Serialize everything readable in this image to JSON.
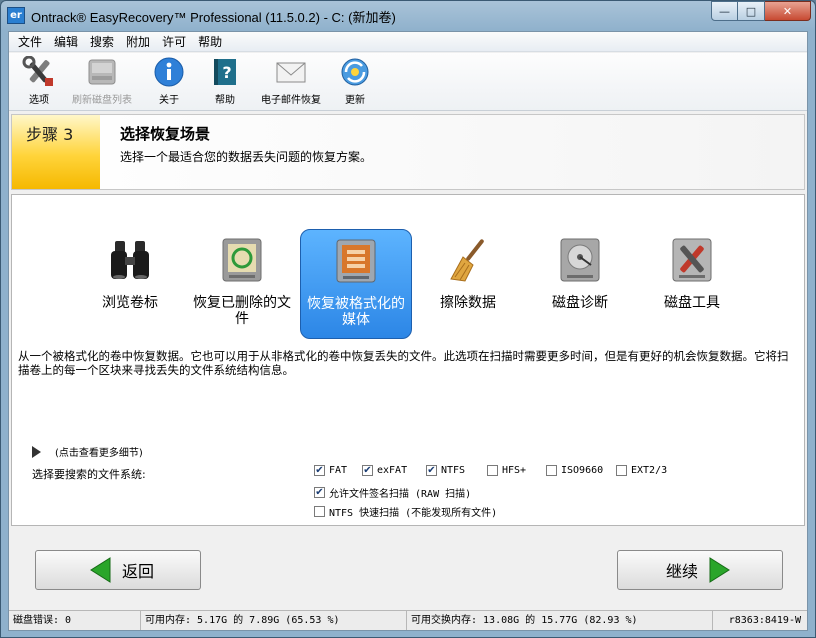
{
  "window": {
    "app_icon": "er",
    "title": "Ontrack® EasyRecovery™ Professional (11.5.0.2) - C: (新加卷)",
    "minimize_icon": "minimize-icon",
    "maximize_icon": "maximize-icon",
    "close_icon": "close-icon"
  },
  "menu": [
    "文件",
    "编辑",
    "搜索",
    "附加",
    "许可",
    "帮助"
  ],
  "toolbar": [
    {
      "label": "选项",
      "icon": "tools-icon",
      "enabled": true
    },
    {
      "label": "刷新磁盘列表",
      "icon": "disk-refresh-icon",
      "enabled": false
    },
    {
      "label": "关于",
      "icon": "info-icon",
      "enabled": true
    },
    {
      "label": "帮助",
      "icon": "help-book-icon",
      "enabled": true
    },
    {
      "label": "电子邮件恢复",
      "icon": "envelope-icon",
      "enabled": true
    },
    {
      "label": "更新",
      "icon": "update-globe-icon",
      "enabled": true
    }
  ],
  "step": {
    "number": "步骤 3",
    "title": "选择恢复场景",
    "subtitle": "选择一个最适合您的数据丢失问题的恢复方案。"
  },
  "scenarios": [
    {
      "label": "浏览卷标",
      "icon": "binoculars-icon",
      "selected": false
    },
    {
      "label": "恢复已删除的文件",
      "icon": "recycle-drive-icon",
      "selected": false
    },
    {
      "label": "恢复被格式化的媒体",
      "icon": "format-drive-icon",
      "selected": true
    },
    {
      "label": "擦除数据",
      "icon": "broom-icon",
      "selected": false
    },
    {
      "label": "磁盘诊断",
      "icon": "hdd-diagnose-icon",
      "selected": false
    },
    {
      "label": "磁盘工具",
      "icon": "disk-tools-icon",
      "selected": false
    }
  ],
  "description": "从一个被格式化的卷中恢复数据。它也可以用于从非格式化的卷中恢复丢失的文件。此选项在扫描时需要更多时间，但是有更好的机会恢复数据。它将扫描卷上的每一个区块来寻找丢失的文件系统结构信息。",
  "more_details": "(点击查看更多细节)",
  "fs_label": "选择要搜索的文件系统:",
  "filesystems": [
    {
      "label": "FAT",
      "checked": true
    },
    {
      "label": "exFAT",
      "checked": true
    },
    {
      "label": "NTFS",
      "checked": true
    },
    {
      "label": "HFS+",
      "checked": false
    },
    {
      "label": "ISO9660",
      "checked": false
    },
    {
      "label": "EXT2/3",
      "checked": false
    }
  ],
  "options": [
    {
      "label": "允许文件签名扫描 (RAW 扫描)",
      "checked": true
    },
    {
      "label": "NTFS 快速扫描 (不能发现所有文件)",
      "checked": false
    }
  ],
  "buttons": {
    "back": "返回",
    "next": "继续"
  },
  "status": {
    "disk_errors": "磁盘错误: 0",
    "memory": "可用内存: 5.17G 的 7.89G (65.53 %)",
    "swap": "可用交换内存: 13.08G 的 15.77G (82.93 %)",
    "build": "r8363:8419-W"
  },
  "colors": {
    "selected": "#2c86e6",
    "step_badge": "#ffd43a",
    "arrow_green": "#2aa52a"
  }
}
